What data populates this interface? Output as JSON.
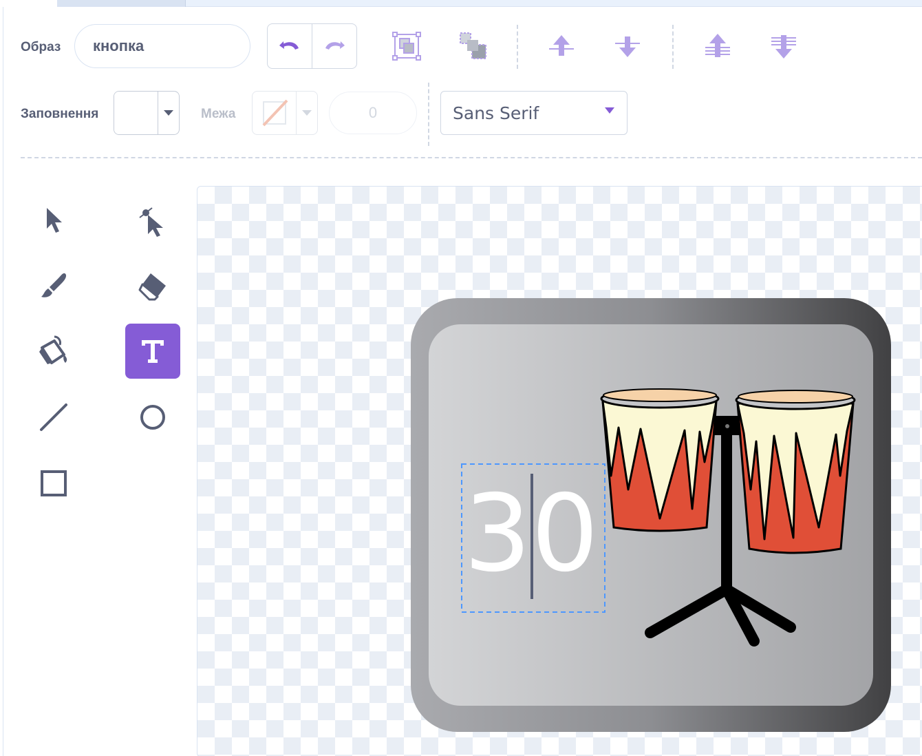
{
  "toolbar": {
    "costume_label": "Образ",
    "costume_name": "кнопка",
    "fill_label": "Заповнення",
    "fill_color": "#ffffff",
    "outline_label": "Межа",
    "outline_width": "0",
    "font": "Sans Serif",
    "buttons": [
      "undo-icon",
      "redo-icon",
      "group-icon",
      "ungroup-icon",
      "forward-icon",
      "backward-icon",
      "front-icon",
      "back-icon"
    ]
  },
  "tools": [
    {
      "icon": "select-arrow-icon",
      "active": false
    },
    {
      "icon": "reshape-icon",
      "active": false
    },
    {
      "icon": "brush-icon",
      "active": false
    },
    {
      "icon": "eraser-icon",
      "active": false
    },
    {
      "icon": "fill-bucket-icon",
      "active": false
    },
    {
      "icon": "text-icon",
      "active": true
    },
    {
      "icon": "line-icon",
      "active": false
    },
    {
      "icon": "circle-icon",
      "active": false
    },
    {
      "icon": "rectangle-icon",
      "active": false
    }
  ],
  "canvas": {
    "text_value": "30"
  },
  "colors": {
    "accent": "#855cd6",
    "accent_light": "#b3a1e8",
    "text": "#575e75",
    "drum_red": "#e05037",
    "drum_cream": "#fbf8d4",
    "drum_head": "#f6d2a8"
  }
}
